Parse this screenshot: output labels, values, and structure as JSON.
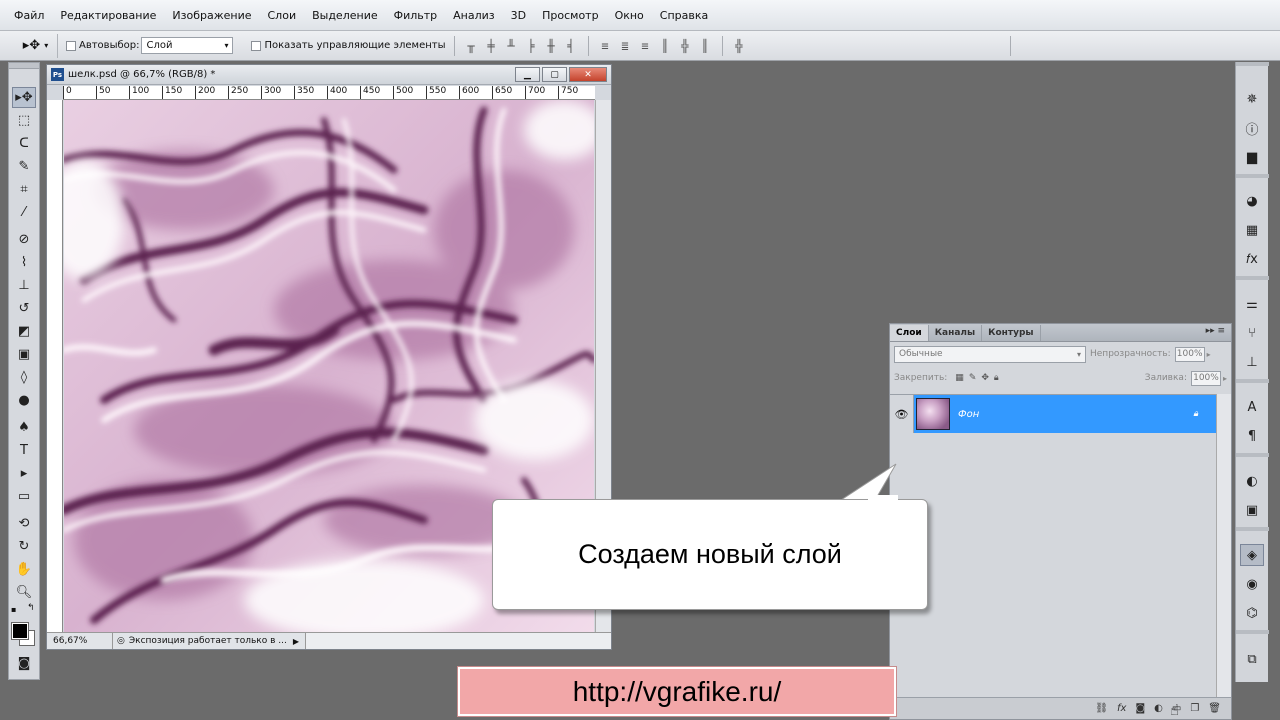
{
  "menu": [
    "Файл",
    "Редактирование",
    "Изображение",
    "Слои",
    "Выделение",
    "Фильтр",
    "Анализ",
    "3D",
    "Просмотр",
    "Окно",
    "Справка"
  ],
  "options": {
    "autoselect_label": "Автовыбор:",
    "autoselect_value": "Слой",
    "show_controls_label": "Показать управляющие элементы"
  },
  "document": {
    "title": "шелк.psd @ 66,7% (RGB/8) *",
    "ps_badge": "Ps",
    "ruler_ticks": [
      "0",
      "50",
      "100",
      "150",
      "200",
      "250",
      "300",
      "350",
      "400",
      "450",
      "500",
      "550",
      "600",
      "650",
      "700",
      "750"
    ],
    "zoom": "66,67%",
    "status_text": "Экспозиция работает только в ..."
  },
  "layers_panel": {
    "tabs": [
      "Слои",
      "Каналы",
      "Контуры"
    ],
    "blend_mode": "Обычные",
    "opacity_label": "Непрозрачность:",
    "opacity_value": "100%",
    "lock_label": "Закрепить:",
    "fill_label": "Заливка:",
    "fill_value": "100%",
    "layer_name": "Фон",
    "bottom_icons": [
      "link-icon",
      "fx-icon",
      "mask-icon",
      "adjustment-icon",
      "group-icon",
      "new-layer-icon",
      "trash-icon"
    ]
  },
  "callout_text": "Создаем новый слой",
  "url_text": "http://vgrafike.ru/",
  "tool_icons": [
    "move-icon",
    "marquee-icon",
    "lasso-icon",
    "quick-select-icon",
    "crop-icon",
    "eyedropper-icon",
    "healing-icon",
    "brush-icon",
    "stamp-icon",
    "history-brush-icon",
    "eraser-icon",
    "gradient-icon",
    "blur-icon",
    "dodge-icon",
    "pen-icon",
    "type-icon",
    "path-select-icon",
    "shape-icon",
    "3d-rotate-icon",
    "3d-orbit-icon",
    "hand-icon",
    "zoom-icon"
  ],
  "colors": {
    "selection": "#3399ff",
    "url_banner": "#f2a7a8",
    "silk_dark": "#5c2450",
    "silk_light": "#f6e8f2"
  }
}
